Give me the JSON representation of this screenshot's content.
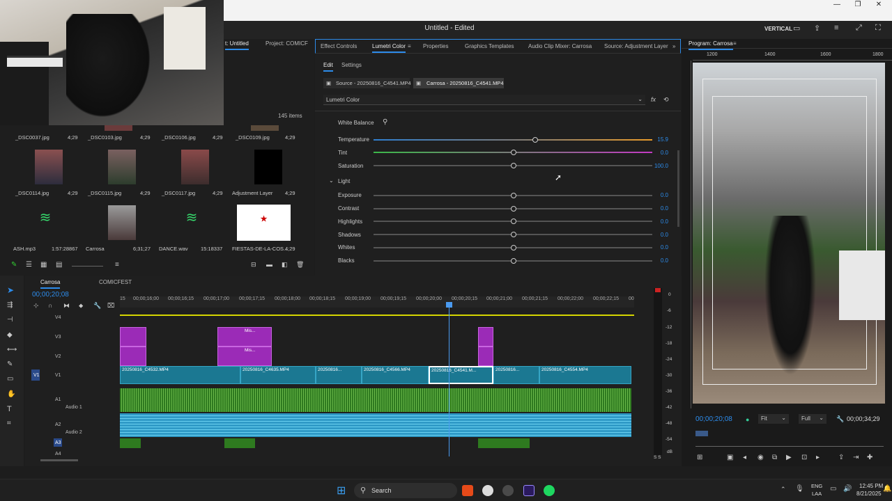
{
  "window": {
    "title": "Untitled - Edited",
    "vertical": "VERTICAL"
  },
  "left_tabs": [
    "t: Untitled",
    "Project: COMICF"
  ],
  "project": {
    "items_count": "145 items",
    "items": [
      {
        "name": "_DSC0037.jpg",
        "dur": "4;29"
      },
      {
        "name": "_DSC0103.jpg",
        "dur": "4;29"
      },
      {
        "name": "_DSC0106.jpg",
        "dur": "4;29"
      },
      {
        "name": "_DSC0109.jpg",
        "dur": "4;29"
      },
      {
        "name": "_DSC0114.jpg",
        "dur": "4;29"
      },
      {
        "name": "_DSC0115.jpg",
        "dur": "4;29"
      },
      {
        "name": "_DSC0117.jpg",
        "dur": "4;29"
      },
      {
        "name": "Adjustment Layer",
        "dur": "4;29"
      },
      {
        "name": "ASH.mp3",
        "dur": "1:57:28867"
      },
      {
        "name": "Carrosa",
        "dur": "6;31;27"
      },
      {
        "name": "DANCE.wav",
        "dur": "15:18337"
      },
      {
        "name": "FIESTAS-DE-LA-COS...",
        "dur": "4;29"
      }
    ]
  },
  "lumetri": {
    "tabs": [
      "Effect Controls",
      "Lumetri Color",
      "Properties",
      "Graphics Templates",
      "Audio Clip Mixer: Carrosa",
      "Source: Adjustment Layer"
    ],
    "subtabs": [
      "Edit",
      "Settings"
    ],
    "source": "Source - 20250816_C4541.MP4",
    "clip": "Carrosa - 20250816_C4541.MP4",
    "effect": "Lumetri Color",
    "white_balance": "White Balance",
    "light": "Light",
    "wb_controls": [
      {
        "label": "Temperature",
        "value": "15.9",
        "pos": 0.58
      },
      {
        "label": "Tint",
        "value": "0.0",
        "pos": 0.5
      },
      {
        "label": "Saturation",
        "value": "100.0",
        "pos": 0.5
      }
    ],
    "light_controls": [
      {
        "label": "Exposure",
        "value": "0.0"
      },
      {
        "label": "Contrast",
        "value": "0.0"
      },
      {
        "label": "Highlights",
        "value": "0.0"
      },
      {
        "label": "Shadows",
        "value": "0.0"
      },
      {
        "label": "Whites",
        "value": "0.0"
      },
      {
        "label": "Blacks",
        "value": "0.0"
      }
    ]
  },
  "program": {
    "title": "Program: Carrosa",
    "ruler": [
      "1200",
      "1400",
      "1600",
      "1800"
    ],
    "timecode": "00;00;20;08",
    "fit": "Fit",
    "full": "Full",
    "duration": "00;00;34;29"
  },
  "timeline": {
    "tabs": [
      "Carrosa",
      "COMICFEST"
    ],
    "timecode": "00;00;20;08",
    "ticks": [
      "15",
      "00;00;16;00",
      "00;00;16;15",
      "00;00;17;00",
      "00;00;17;15",
      "00;00;18;00",
      "00;00;18;15",
      "00;00;19;00",
      "00;00;19;15",
      "00;00;20;00",
      "00;00;20;15",
      "00;00;21;00",
      "00;00;21;15",
      "00;00;22;00",
      "00;00;22;15",
      "00"
    ],
    "tracks": [
      "V4",
      "V3",
      "V2",
      "V1",
      "A1",
      "A2",
      "A3",
      "A4"
    ],
    "audio_names": [
      "Audio 1",
      "Audio 2"
    ],
    "v1_clips": [
      "20250816_C4532.MP4",
      "20250816_C4635.MP4",
      "20250816...",
      "20250816_C4566.MP4",
      "20250816_C4541.M...",
      "20250816...",
      "20250816_C4554.MP4"
    ],
    "adj_label": "Mis...",
    "meter": [
      "0",
      "-6",
      "-12",
      "-18",
      "-24",
      "-30",
      "-36",
      "-42",
      "-48",
      "-54",
      "dB"
    ],
    "meter_bottom": "S S"
  },
  "taskbar": {
    "search": "Search",
    "lang1": "ENG",
    "lang2": "LAA",
    "time": "12:45 PM",
    "date": "8/21/2025"
  }
}
